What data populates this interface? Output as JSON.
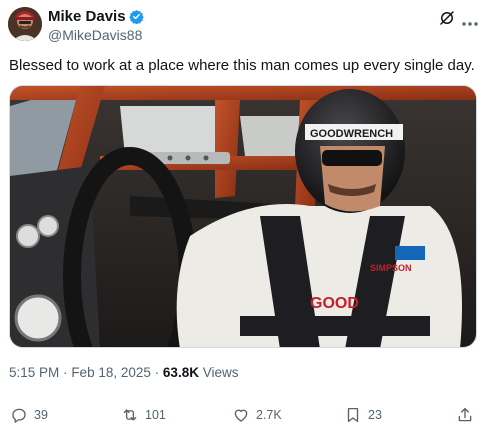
{
  "author": {
    "name": "Mike Davis",
    "handle": "@MikeDavis88",
    "verified": true
  },
  "tweet": {
    "text": "Blessed to work at a place where this man comes up every single day."
  },
  "media": {
    "alt_icon": "photo-race-car-driver",
    "visor_text": "GOODWRENCH",
    "helmet_brand": "Goodwrench",
    "belt_text": "SIMPSON",
    "suit_logo": "GOOD"
  },
  "meta": {
    "time": "5:15 PM",
    "separator": "·",
    "date": "Feb 18, 2025",
    "views_count": "63.8K",
    "views_label": "Views"
  },
  "actions": {
    "replies": "39",
    "reposts": "101",
    "likes": "2.7K",
    "bookmarks": "23"
  },
  "colors": {
    "verified_blue": "#1d9bf0",
    "text_primary": "#0f1419",
    "text_secondary": "#536471"
  }
}
